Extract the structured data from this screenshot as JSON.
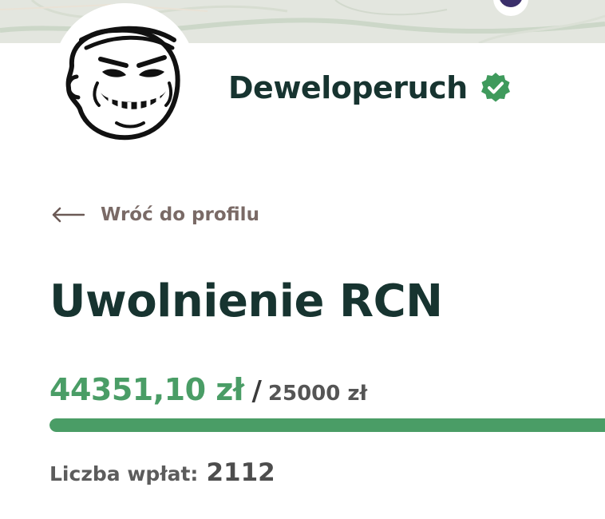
{
  "profile": {
    "name": "Deweloperuch",
    "verified": true,
    "avatar_icon": "trollface-avatar",
    "verified_icon": "verified-badge-icon"
  },
  "navigation": {
    "back_label": "Wróć do profilu",
    "back_icon": "arrow-left-icon"
  },
  "fundraiser": {
    "title": "Uwolnienie RCN",
    "raised": "44351,10 zł",
    "separator": "/",
    "goal": "25000 zł",
    "progress_fraction": 1.0,
    "donations_label": "Liczba wpłat:",
    "donations_count": "2112"
  },
  "colors": {
    "accent_green": "#4a9d66",
    "heading_dark": "#173430",
    "muted_brown": "#7a6a66",
    "banner_map": "#e4e7e0"
  }
}
